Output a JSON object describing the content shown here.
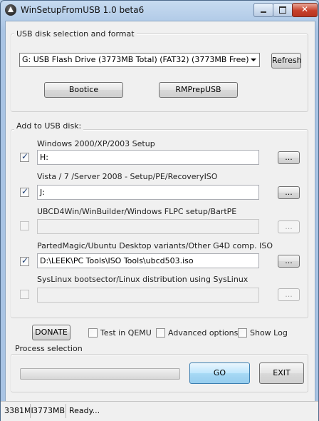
{
  "window": {
    "title": "WinSetupFromUSB 1.0 beta6"
  },
  "usb_group": {
    "legend": "USB disk selection and format",
    "drive_selected": "G: USB Flash Drive (3773MB Total) (FAT32) (3773MB Free)",
    "refresh_label": "Refresh",
    "bootice_label": "Bootice",
    "rmprep_label": "RMPrepUSB"
  },
  "add_group": {
    "legend": "Add to USB disk:",
    "items": [
      {
        "label": "Windows 2000/XP/2003 Setup",
        "path": "H:",
        "checked": true,
        "enabled": true,
        "browse": "..."
      },
      {
        "label": "Vista / 7 /Server 2008 - Setup/PE/RecoveryISO",
        "path": "J:",
        "checked": true,
        "enabled": true,
        "browse": "..."
      },
      {
        "label": "UBCD4Win/WinBuilder/Windows FLPC setup/BartPE",
        "path": "",
        "checked": false,
        "enabled": false,
        "browse": "..."
      },
      {
        "label": "PartedMagic/Ubuntu Desktop variants/Other G4D comp. ISO",
        "path": "D:\\LEEK\\PC Tools\\ISO Tools\\ubcd503.iso",
        "checked": true,
        "enabled": true,
        "browse": "..."
      },
      {
        "label": "SysLinux bootsector/Linux distribution using SysLinux",
        "path": "",
        "checked": false,
        "enabled": false,
        "browse": "..."
      }
    ]
  },
  "options": {
    "donate_label": "DONATE",
    "test_qemu_label": "Test in QEMU",
    "advanced_label": "Advanced options",
    "show_log_label": "Show Log"
  },
  "process": {
    "legend": "Process selection",
    "progress": 0,
    "go_label": "GO",
    "exit_label": "EXIT"
  },
  "status_bar": {
    "free": "3381MI",
    "total": "3773MB",
    "message": "Ready..."
  }
}
